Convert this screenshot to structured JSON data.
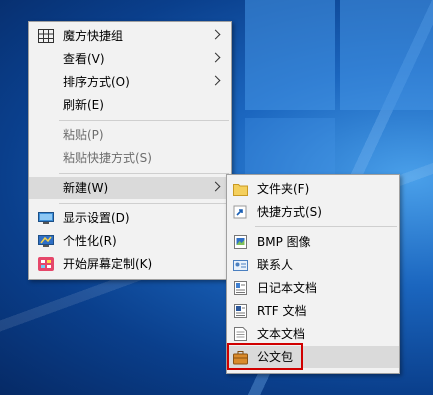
{
  "context_menu": {
    "items": [
      {
        "label": "魔方快捷组",
        "icon": "grid-icon",
        "submenu": true
      },
      {
        "label": "查看(V)",
        "submenu": true
      },
      {
        "label": "排序方式(O)",
        "submenu": true
      },
      {
        "label": "刷新(E)"
      },
      {
        "label": "粘贴(P)",
        "disabled": true
      },
      {
        "label": "粘贴快捷方式(S)",
        "disabled": true
      },
      {
        "label": "新建(W)",
        "submenu": true,
        "highlighted": true
      },
      {
        "label": "显示设置(D)",
        "icon": "display-icon"
      },
      {
        "label": "个性化(R)",
        "icon": "personalize-icon"
      },
      {
        "label": "开始屏幕定制(K)",
        "icon": "start-screen-icon"
      }
    ]
  },
  "new_submenu": {
    "items": [
      {
        "label": "文件夹(F)",
        "icon": "folder-icon"
      },
      {
        "label": "快捷方式(S)",
        "icon": "shortcut-icon"
      },
      {
        "label": "BMP 图像",
        "icon": "bmp-image-icon"
      },
      {
        "label": "联系人",
        "icon": "contact-icon"
      },
      {
        "label": "日记本文档",
        "icon": "journal-icon"
      },
      {
        "label": "RTF 文档",
        "icon": "rtf-document-icon"
      },
      {
        "label": "文本文档",
        "icon": "text-document-icon"
      },
      {
        "label": "公文包",
        "icon": "briefcase-icon",
        "highlighted": true
      }
    ]
  },
  "colors": {
    "menu_bg": "#f2f2f2",
    "highlight": "#dadada",
    "annotation_box": "#d00000"
  }
}
